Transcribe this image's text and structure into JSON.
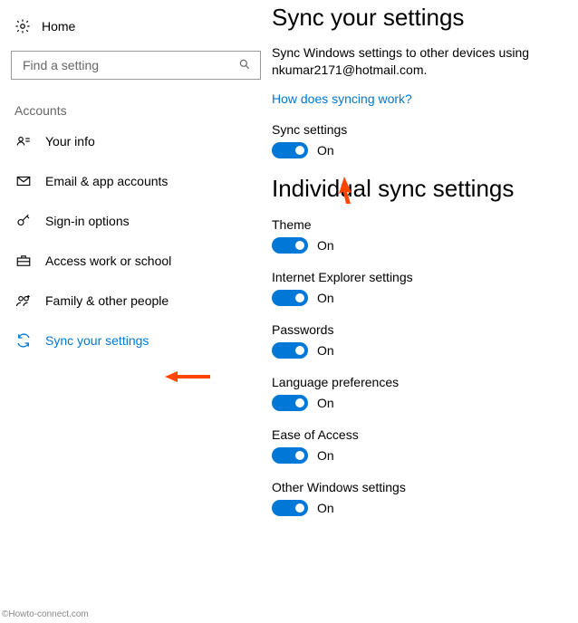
{
  "home_label": "Home",
  "search": {
    "placeholder": "Find a setting"
  },
  "section_label": "Accounts",
  "nav": {
    "your_info": "Your info",
    "email": "Email & app accounts",
    "signin": "Sign-in options",
    "work": "Access work or school",
    "family": "Family & other people",
    "sync": "Sync your settings"
  },
  "page": {
    "title": "Sync your settings",
    "description_line1": "Sync Windows settings to other devices using",
    "description_line2": "nkumar2171@hotmail.com.",
    "help_link": "How does syncing work?",
    "subsection_title": "Individual sync settings"
  },
  "toggles": {
    "sync": {
      "label": "Sync settings",
      "state": "On"
    },
    "theme": {
      "label": "Theme",
      "state": "On"
    },
    "ie": {
      "label": "Internet Explorer settings",
      "state": "On"
    },
    "passwords": {
      "label": "Passwords",
      "state": "On"
    },
    "language": {
      "label": "Language preferences",
      "state": "On"
    },
    "ease": {
      "label": "Ease of Access",
      "state": "On"
    },
    "other": {
      "label": "Other Windows settings",
      "state": "On"
    }
  },
  "watermark": "©Howto-connect.com"
}
